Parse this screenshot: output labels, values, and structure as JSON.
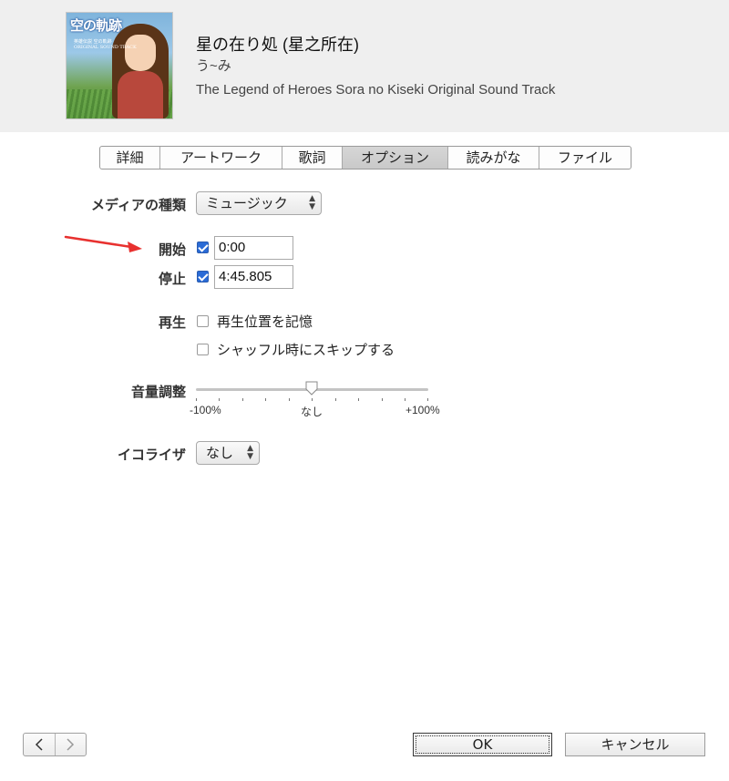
{
  "track": {
    "title": "星の在り処 (星之所在)",
    "artist": "う~み",
    "album": "The Legend of Heroes Sora no Kiseki Original Sound Track"
  },
  "album_art": {
    "logo_text": "空の軌跡",
    "subtitle_lines": [
      "英雄伝説 空の軌跡",
      "ORIGINAL SOUND TRACK"
    ]
  },
  "tabs": [
    {
      "label": "詳細",
      "active": false
    },
    {
      "label": "アートワーク",
      "active": false
    },
    {
      "label": "歌詞",
      "active": false
    },
    {
      "label": "オプション",
      "active": true
    },
    {
      "label": "読みがな",
      "active": false
    },
    {
      "label": "ファイル",
      "active": false
    }
  ],
  "media_kind": {
    "label": "メディアの種類",
    "value": "ミュージック"
  },
  "start": {
    "label": "開始",
    "checked": true,
    "value": "0:00"
  },
  "stop": {
    "label": "停止",
    "checked": true,
    "value": "4:45.805"
  },
  "playback": {
    "label": "再生",
    "remember_position": {
      "label": "再生位置を記憶",
      "checked": false
    },
    "skip_shuffle": {
      "label": "シャッフル時にスキップする",
      "checked": false
    }
  },
  "volume": {
    "label": "音量調整",
    "min_label": "-100%",
    "mid_label": "なし",
    "max_label": "+100%",
    "value_percent": 0
  },
  "equalizer": {
    "label": "イコライザ",
    "value": "なし"
  },
  "buttons": {
    "prev_icon": "chevron-left-icon",
    "next_icon": "chevron-right-icon",
    "ok": "OK",
    "cancel": "キャンセル"
  },
  "colors": {
    "header_bg": "#efefef",
    "checkbox_blue": "#2a6bd6",
    "annotation_arrow": "#e8312f"
  }
}
